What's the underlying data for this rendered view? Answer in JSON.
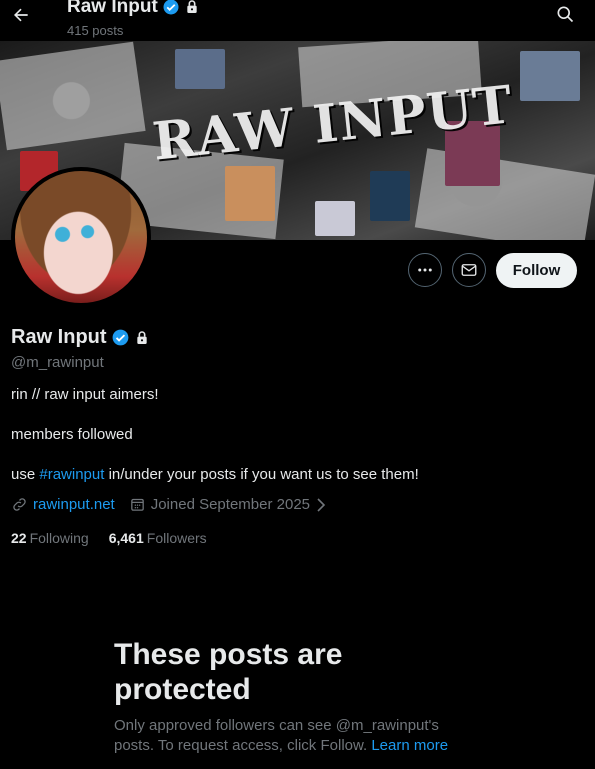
{
  "header": {
    "title": "Raw Input",
    "posts_count": "415 posts",
    "back_icon": "back-arrow-icon",
    "search_icon": "search-icon"
  },
  "banner": {
    "title": "RAW INPUT"
  },
  "actions": {
    "more_icon": "more-icon",
    "message_icon": "message-icon",
    "follow_label": "Follow"
  },
  "profile": {
    "name": "Raw Input",
    "handle": "@m_rawinput",
    "verified": true,
    "protected": true,
    "bio": {
      "line1": "rin // raw input aimers!",
      "line2": "members followed",
      "line3_prefix": "use ",
      "line3_hashtag": "#rawinput",
      "line3_suffix": " in/under your posts if you want us to see them!"
    },
    "website": "rawinput.net",
    "joined": "Joined September 2025"
  },
  "stats": {
    "following_count": "22",
    "following_label": "Following",
    "followers_count": "6,461",
    "followers_label": "Followers"
  },
  "protected_notice": {
    "title": "These posts are protected",
    "text": "Only approved followers can see @m_rawinput's posts. To request access, click Follow.",
    "learn_more": "Learn more"
  },
  "colors": {
    "background": "#000000",
    "accent": "#1d9bf0",
    "muted_text": "#71767b",
    "primary_text": "#e7e9ea"
  }
}
